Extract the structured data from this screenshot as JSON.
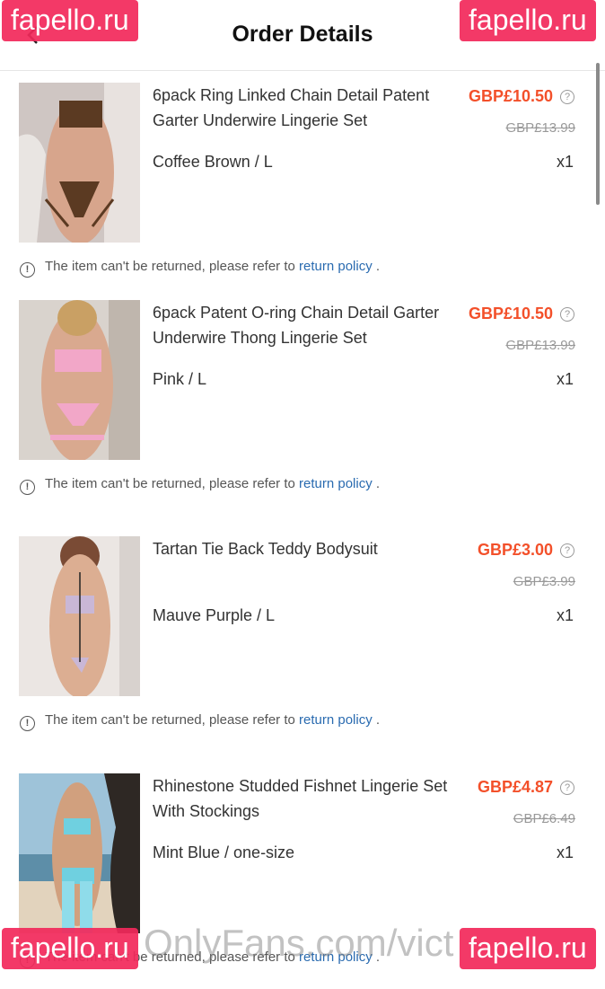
{
  "header": {
    "title": "Order Details"
  },
  "items": [
    {
      "name": "6pack Ring Linked Chain Detail Patent Garter Underwire Lingerie Set",
      "price": "GBP£10.50",
      "original_price": "GBP£13.99",
      "variant": "Coffee Brown / L",
      "quantity": "x1",
      "notice": {
        "text": "The item can't be returned, please refer to ",
        "link": "return policy",
        "end": " ."
      }
    },
    {
      "name": "6pack Patent O-ring Chain Detail Garter Underwire Thong Lingerie Set",
      "price": "GBP£10.50",
      "original_price": "GBP£13.99",
      "variant": "Pink / L",
      "quantity": "x1",
      "notice": {
        "text": "The item can't be returned, please refer to ",
        "link": "return policy",
        "end": " ."
      }
    },
    {
      "name": "Tartan Tie Back Teddy Bodysuit",
      "price": "GBP£3.00",
      "original_price": "GBP£3.99",
      "variant": "Mauve Purple / L",
      "quantity": "x1",
      "notice": {
        "text": "The item can't be returned, please refer to ",
        "link": "return policy",
        "end": " ."
      }
    },
    {
      "name": "Rhinestone Studded Fishnet Lingerie Set With Stockings",
      "price": "GBP£4.87",
      "original_price": "GBP£6.49",
      "variant": "Mint Blue / one-size",
      "quantity": "x1",
      "notice": {
        "text": "The item can't be returned, please refer to ",
        "link": "return policy",
        "end": " ."
      }
    }
  ],
  "watermarks": {
    "site": "fapello.ru",
    "bottom_text": "OnlyFans.com/vict"
  },
  "colors": {
    "price": "#f3502a",
    "link": "#2a6bb0",
    "watermark": "#f2295b"
  }
}
